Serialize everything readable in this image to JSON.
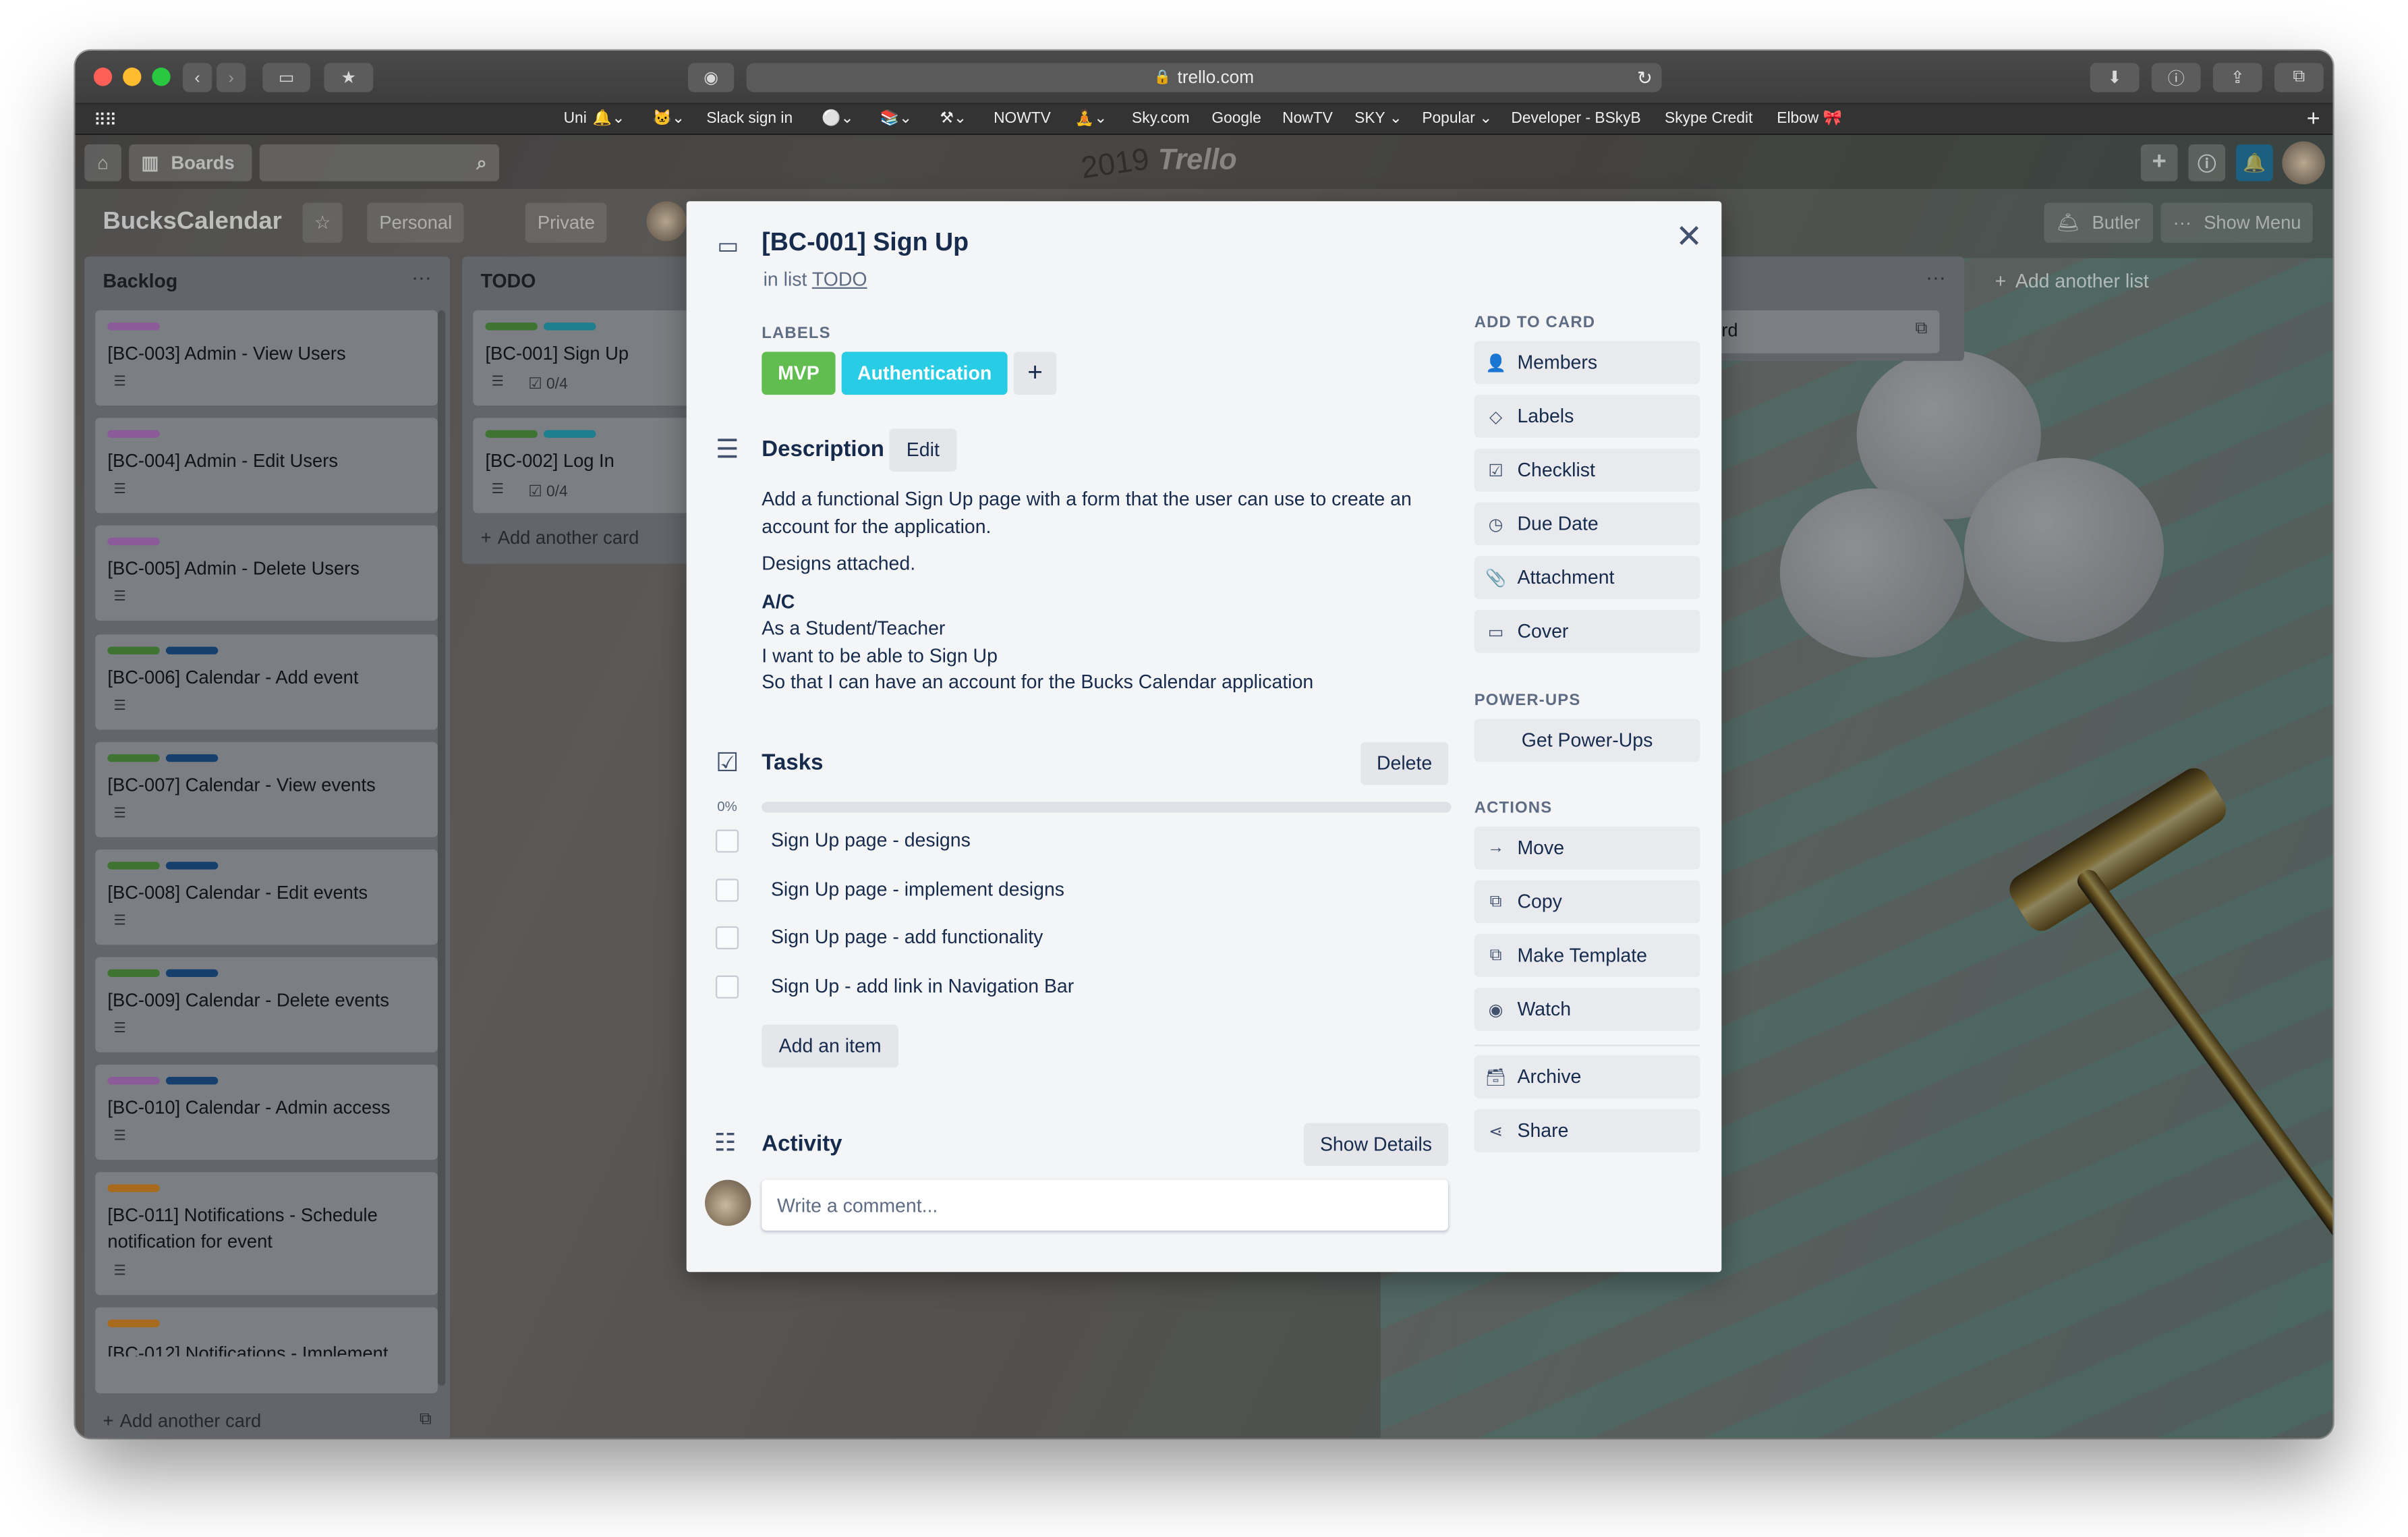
{
  "browser": {
    "url": "trello.com",
    "bookmarks": [
      "Uni",
      "Slack sign in",
      "NOWTV",
      "Sky.com",
      "Google",
      "NowTV",
      "SKY",
      "Popular",
      "Developer - BSkyB",
      "Skype Credit",
      "Elbow"
    ]
  },
  "appbar": {
    "boards_label": "Boards",
    "logo": "Trello",
    "year_watermark": "2019"
  },
  "board": {
    "title": "BucksCalendar",
    "visibility_team": "Personal",
    "visibility": "Private",
    "butler_label": "Butler",
    "show_menu_label": "Show Menu",
    "add_list_label": "Add another list"
  },
  "lists": {
    "backlog": {
      "title": "Backlog",
      "cards": [
        {
          "title": "[BC-003] Admin - View Users"
        },
        {
          "title": "[BC-004] Admin - Edit Users"
        },
        {
          "title": "[BC-005] Admin - Delete Users"
        },
        {
          "title": "[BC-006] Calendar - Add event"
        },
        {
          "title": "[BC-007] Calendar - View events"
        },
        {
          "title": "[BC-008] Calendar - Edit events"
        },
        {
          "title": "[BC-009] Calendar - Delete events"
        },
        {
          "title": "[BC-010] Calendar - Admin access"
        },
        {
          "title": "[BC-011] Notifications - Schedule notification for event"
        },
        {
          "title": "[BC-012] Notifications - Implement"
        }
      ],
      "add_card": "Add another card"
    },
    "todo": {
      "title": "TODO",
      "cards": [
        {
          "title": "[BC-001] Sign Up",
          "checklist": "0/4"
        },
        {
          "title": "[BC-002] Log In",
          "checklist": "0/4"
        }
      ],
      "add_card": "Add another card"
    },
    "third": {
      "partial_text": "rd"
    }
  },
  "modal": {
    "title": "[BC-001] Sign Up",
    "in_list_prefix": "in list",
    "list_name": "TODO",
    "labels_heading": "LABELS",
    "labels": [
      {
        "name": "MVP",
        "color": "#61bd4f"
      },
      {
        "name": "Authentication",
        "color": "#29cce5"
      }
    ],
    "add_label": "+",
    "description_heading": "Description",
    "edit_label": "Edit",
    "description": {
      "p1": "Add a functional Sign Up page with a form that the user can use to create an account for the application.",
      "p2": "Designs attached.",
      "ac_heading": "A/C",
      "ac1": "As a Student/Teacher",
      "ac2": "I want to be able to Sign Up",
      "ac3": "So that I can have an account for the Bucks Calendar application"
    },
    "tasks_heading": "Tasks",
    "delete_label": "Delete",
    "progress_text": "0%",
    "progress": 0,
    "tasks": [
      {
        "label": "Sign Up page - designs",
        "checked": false
      },
      {
        "label": "Sign Up page - implement designs",
        "checked": false
      },
      {
        "label": "Sign Up page - add functionality",
        "checked": false
      },
      {
        "label": "Sign Up - add link in Navigation Bar",
        "checked": false
      }
    ],
    "add_item_label": "Add an item",
    "activity_heading": "Activity",
    "show_details_label": "Show Details",
    "comment_placeholder": "Write a comment...",
    "sidebar": {
      "add_to_card_heading": "ADD TO CARD",
      "add_to_card": [
        "Members",
        "Labels",
        "Checklist",
        "Due Date",
        "Attachment",
        "Cover"
      ],
      "powerups_heading": "POWER-UPS",
      "get_powerups": "Get Power-Ups",
      "actions_heading": "ACTIONS",
      "actions": [
        "Move",
        "Copy",
        "Make Template",
        "Watch"
      ],
      "archive": "Archive",
      "share": "Share"
    }
  },
  "colors": {
    "label_green": "#61bd4f",
    "label_sky": "#29cce5",
    "label_purple": "#c377e0",
    "label_blue": "#0079bf",
    "label_orange": "#ff9f1a",
    "text_dark": "#172b4d"
  }
}
